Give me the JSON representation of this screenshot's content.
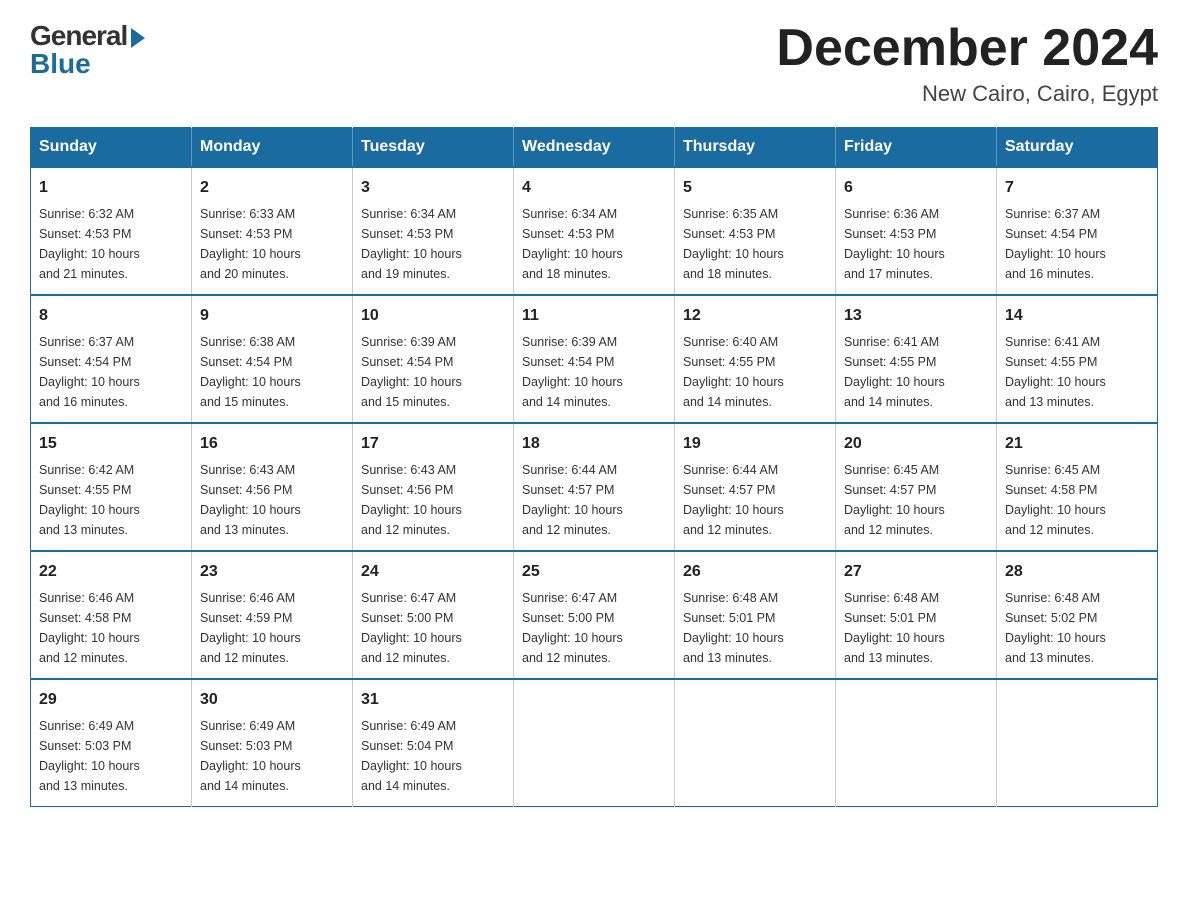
{
  "logo": {
    "general": "General",
    "blue": "Blue"
  },
  "title": "December 2024",
  "location": "New Cairo, Cairo, Egypt",
  "days_header": [
    "Sunday",
    "Monday",
    "Tuesday",
    "Wednesday",
    "Thursday",
    "Friday",
    "Saturday"
  ],
  "weeks": [
    [
      {
        "day": "1",
        "sunrise": "6:32 AM",
        "sunset": "4:53 PM",
        "daylight": "10 hours and 21 minutes."
      },
      {
        "day": "2",
        "sunrise": "6:33 AM",
        "sunset": "4:53 PM",
        "daylight": "10 hours and 20 minutes."
      },
      {
        "day": "3",
        "sunrise": "6:34 AM",
        "sunset": "4:53 PM",
        "daylight": "10 hours and 19 minutes."
      },
      {
        "day": "4",
        "sunrise": "6:34 AM",
        "sunset": "4:53 PM",
        "daylight": "10 hours and 18 minutes."
      },
      {
        "day": "5",
        "sunrise": "6:35 AM",
        "sunset": "4:53 PM",
        "daylight": "10 hours and 18 minutes."
      },
      {
        "day": "6",
        "sunrise": "6:36 AM",
        "sunset": "4:53 PM",
        "daylight": "10 hours and 17 minutes."
      },
      {
        "day": "7",
        "sunrise": "6:37 AM",
        "sunset": "4:54 PM",
        "daylight": "10 hours and 16 minutes."
      }
    ],
    [
      {
        "day": "8",
        "sunrise": "6:37 AM",
        "sunset": "4:54 PM",
        "daylight": "10 hours and 16 minutes."
      },
      {
        "day": "9",
        "sunrise": "6:38 AM",
        "sunset": "4:54 PM",
        "daylight": "10 hours and 15 minutes."
      },
      {
        "day": "10",
        "sunrise": "6:39 AM",
        "sunset": "4:54 PM",
        "daylight": "10 hours and 15 minutes."
      },
      {
        "day": "11",
        "sunrise": "6:39 AM",
        "sunset": "4:54 PM",
        "daylight": "10 hours and 14 minutes."
      },
      {
        "day": "12",
        "sunrise": "6:40 AM",
        "sunset": "4:55 PM",
        "daylight": "10 hours and 14 minutes."
      },
      {
        "day": "13",
        "sunrise": "6:41 AM",
        "sunset": "4:55 PM",
        "daylight": "10 hours and 14 minutes."
      },
      {
        "day": "14",
        "sunrise": "6:41 AM",
        "sunset": "4:55 PM",
        "daylight": "10 hours and 13 minutes."
      }
    ],
    [
      {
        "day": "15",
        "sunrise": "6:42 AM",
        "sunset": "4:55 PM",
        "daylight": "10 hours and 13 minutes."
      },
      {
        "day": "16",
        "sunrise": "6:43 AM",
        "sunset": "4:56 PM",
        "daylight": "10 hours and 13 minutes."
      },
      {
        "day": "17",
        "sunrise": "6:43 AM",
        "sunset": "4:56 PM",
        "daylight": "10 hours and 12 minutes."
      },
      {
        "day": "18",
        "sunrise": "6:44 AM",
        "sunset": "4:57 PM",
        "daylight": "10 hours and 12 minutes."
      },
      {
        "day": "19",
        "sunrise": "6:44 AM",
        "sunset": "4:57 PM",
        "daylight": "10 hours and 12 minutes."
      },
      {
        "day": "20",
        "sunrise": "6:45 AM",
        "sunset": "4:57 PM",
        "daylight": "10 hours and 12 minutes."
      },
      {
        "day": "21",
        "sunrise": "6:45 AM",
        "sunset": "4:58 PM",
        "daylight": "10 hours and 12 minutes."
      }
    ],
    [
      {
        "day": "22",
        "sunrise": "6:46 AM",
        "sunset": "4:58 PM",
        "daylight": "10 hours and 12 minutes."
      },
      {
        "day": "23",
        "sunrise": "6:46 AM",
        "sunset": "4:59 PM",
        "daylight": "10 hours and 12 minutes."
      },
      {
        "day": "24",
        "sunrise": "6:47 AM",
        "sunset": "5:00 PM",
        "daylight": "10 hours and 12 minutes."
      },
      {
        "day": "25",
        "sunrise": "6:47 AM",
        "sunset": "5:00 PM",
        "daylight": "10 hours and 12 minutes."
      },
      {
        "day": "26",
        "sunrise": "6:48 AM",
        "sunset": "5:01 PM",
        "daylight": "10 hours and 13 minutes."
      },
      {
        "day": "27",
        "sunrise": "6:48 AM",
        "sunset": "5:01 PM",
        "daylight": "10 hours and 13 minutes."
      },
      {
        "day": "28",
        "sunrise": "6:48 AM",
        "sunset": "5:02 PM",
        "daylight": "10 hours and 13 minutes."
      }
    ],
    [
      {
        "day": "29",
        "sunrise": "6:49 AM",
        "sunset": "5:03 PM",
        "daylight": "10 hours and 13 minutes."
      },
      {
        "day": "30",
        "sunrise": "6:49 AM",
        "sunset": "5:03 PM",
        "daylight": "10 hours and 14 minutes."
      },
      {
        "day": "31",
        "sunrise": "6:49 AM",
        "sunset": "5:04 PM",
        "daylight": "10 hours and 14 minutes."
      },
      null,
      null,
      null,
      null
    ]
  ],
  "labels": {
    "sunrise": "Sunrise:",
    "sunset": "Sunset:",
    "daylight": "Daylight:"
  }
}
